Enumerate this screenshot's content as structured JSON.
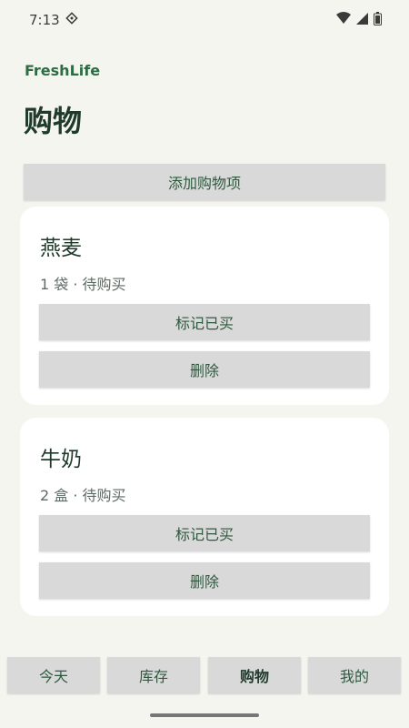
{
  "status": {
    "time": "7:13",
    "icons": [
      "location-diamond-icon",
      "wifi-icon",
      "signal-icon",
      "battery-icon"
    ]
  },
  "app": {
    "brand": "FreshLife",
    "title": "购物"
  },
  "actions": {
    "add_label": "添加购物项"
  },
  "items": [
    {
      "name": "燕麦",
      "detail": "1 袋 · 待购买",
      "mark_label": "标记已买",
      "delete_label": "删除"
    },
    {
      "name": "牛奶",
      "detail": "2 盒 · 待购买",
      "mark_label": "标记已买",
      "delete_label": "删除"
    }
  ],
  "nav": {
    "tabs": [
      {
        "label": "今天"
      },
      {
        "label": "库存"
      },
      {
        "label": "购物"
      },
      {
        "label": "我的"
      }
    ],
    "active": "购物"
  },
  "colors": {
    "accent": "#2f6b44",
    "background": "#f5f5f0",
    "button": "#d9d9d9"
  }
}
